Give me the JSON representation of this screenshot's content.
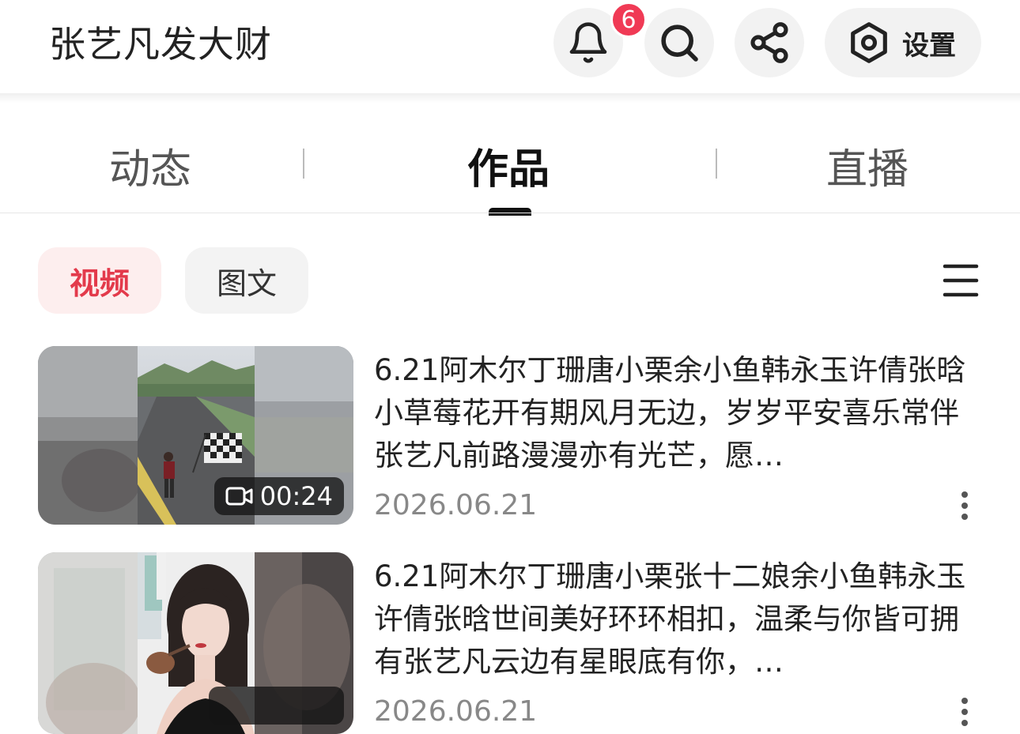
{
  "header": {
    "title": "张艺凡发大财",
    "notification_count": "6",
    "settings_label": "设置",
    "icons": [
      "bell-icon",
      "search-icon",
      "share-icon",
      "settings-icon"
    ]
  },
  "tabs": [
    {
      "label": "动态",
      "active": false
    },
    {
      "label": "作品",
      "active": true
    },
    {
      "label": "直播",
      "active": false
    }
  ],
  "filters": {
    "video_label": "视频",
    "text_label": "图文",
    "active": "视频"
  },
  "colors": {
    "accent": "#e33a4b",
    "badge": "#f03a55",
    "chip_active_bg": "#fdeeee"
  },
  "videos": [
    {
      "title": "6.21阿木尔丁珊唐小栗余小鱼韩永玉许倩张晗小草莓花开有期风月无边，岁岁平安喜乐常伴张艺凡前路漫漫亦有光芒，愿…",
      "date": "2026.06.21",
      "duration": "00:24"
    },
    {
      "title": "6.21阿木尔丁珊唐小栗张十二娘余小鱼韩永玉许倩张晗世间美好环环相扣，温柔与你皆可拥有张艺凡云边有星眼底有你，…",
      "date": "2026.06.21",
      "duration": ""
    }
  ]
}
